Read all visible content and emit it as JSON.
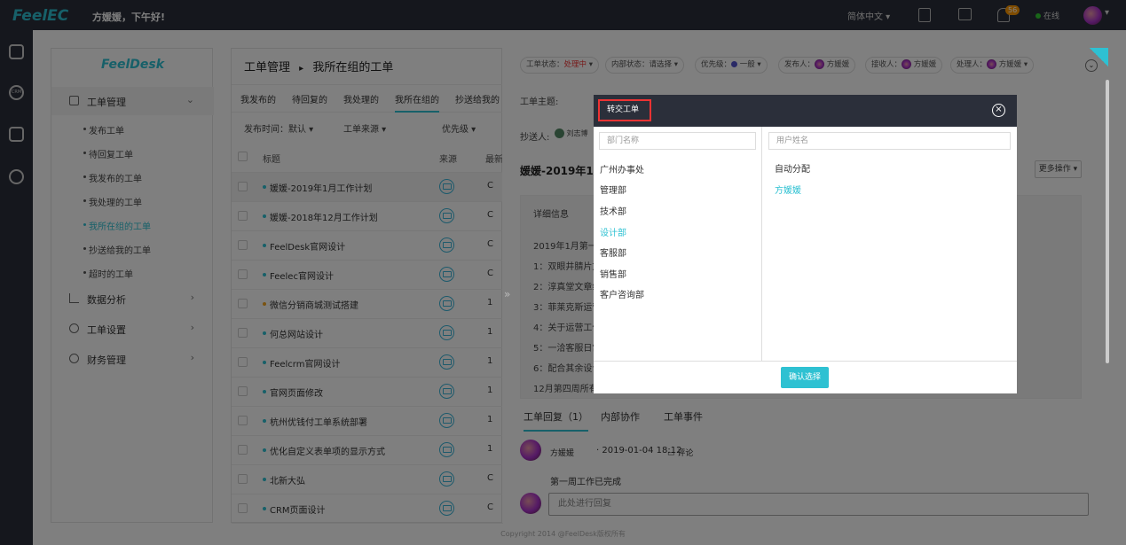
{
  "topbar": {
    "logo": "FeelEC",
    "greeting": "方媛媛，下午好!",
    "language": "简体中文",
    "notification_count": "56",
    "status": "在线"
  },
  "sidebar": {
    "logo": "FeelDesk",
    "menu": [
      {
        "label": "工单管理",
        "icon": "ticket-icon",
        "expanded": true
      },
      {
        "label": "数据分析",
        "icon": "chart-icon"
      },
      {
        "label": "工单设置",
        "icon": "settings-icon"
      },
      {
        "label": "财务管理",
        "icon": "finance-icon"
      }
    ],
    "submenu": [
      {
        "label": "发布工单"
      },
      {
        "label": "待回复工单"
      },
      {
        "label": "我发布的工单"
      },
      {
        "label": "我处理的工单"
      },
      {
        "label": "我所在组的工单",
        "active": true
      },
      {
        "label": "抄送给我的工单"
      },
      {
        "label": "超时的工单"
      }
    ]
  },
  "main": {
    "breadcrumb": "工单管理",
    "separator": "▸",
    "title": "我所在组的工单",
    "tabs": [
      "我发布的",
      "待回复的",
      "我处理的",
      "我所在组的",
      "抄送给我的"
    ],
    "active_tab": 3,
    "filters": [
      "发布时间：默认",
      "工单来源",
      "优先级"
    ],
    "columns": [
      "标题",
      "来源",
      "最新"
    ],
    "rows": [
      {
        "title": "媛媛-2019年1月工作计划",
        "last": "C"
      },
      {
        "title": "媛媛-2018年12月工作计划",
        "last": "C"
      },
      {
        "title": "FeelDesk官网设计",
        "last": "C"
      },
      {
        "title": "Feelec官网设计",
        "last": "C"
      },
      {
        "title": "微信分销商城测试搭建",
        "last": "1",
        "dot_color": "#f5a623"
      },
      {
        "title": "何总网站设计",
        "last": "1"
      },
      {
        "title": "Feelcrm官网设计",
        "last": "1"
      },
      {
        "title": "官网页面修改",
        "last": "1"
      },
      {
        "title": "杭州优钱付工单系统部署",
        "last": "1"
      },
      {
        "title": "优化自定义表单项的显示方式",
        "last": "1"
      },
      {
        "title": "北新大弘",
        "last": "C"
      },
      {
        "title": "CRM页面设计",
        "last": "C"
      }
    ]
  },
  "panel": {
    "chips": [
      {
        "label": "工单状态：",
        "value": "处理中"
      },
      {
        "label": "内部状态：",
        "value": "请选择"
      },
      {
        "label": "优先级：",
        "value": "一般"
      },
      {
        "label": "发布人：",
        "value": "方媛媛"
      },
      {
        "label": "接收人：",
        "value": "方媛媛"
      },
      {
        "label": "处理人：",
        "value": "方媛媛"
      }
    ],
    "subject_label": "工单主题:",
    "cc_label": "抄送人:",
    "cc_user": "刘志博",
    "ticket_title": "媛媛-2019年1月",
    "more_actions": "更多操作",
    "detail_header": "详细信息",
    "detail_lines": [
      "2019年1月第一",
      "1：双眼井腈片文",
      "2：淳真堂文章组",
      "3：菲莱克斯运营",
      "4：关于运营工作",
      "5：一洽客服日常",
      "6：配合其余设计",
      "12月第四周所有"
    ],
    "reply_tabs": [
      "工单回复（1）",
      "内部协作",
      "工单事件"
    ],
    "reply": {
      "author": "方媛媛",
      "time": "· 2019-01-04 18:12",
      "comment_label": "评论",
      "content": "第一周工作已完成"
    },
    "reply_placeholder": "此处进行回复"
  },
  "modal": {
    "title": "转交工单",
    "dept_placeholder": "部门名称",
    "user_placeholder": "用户姓名",
    "departments": [
      {
        "name": "广州办事处"
      },
      {
        "name": "管理部"
      },
      {
        "name": "技术部"
      },
      {
        "name": "设计部",
        "active": true
      },
      {
        "name": "客服部"
      },
      {
        "name": "销售部"
      },
      {
        "name": "客户咨询部"
      }
    ],
    "users": [
      {
        "name": "自动分配"
      },
      {
        "name": "方媛媛",
        "active": true
      }
    ],
    "confirm": "确认选择"
  },
  "footer": {
    "copyright": "Copyright 2014 @FeelDesk版权所有"
  }
}
